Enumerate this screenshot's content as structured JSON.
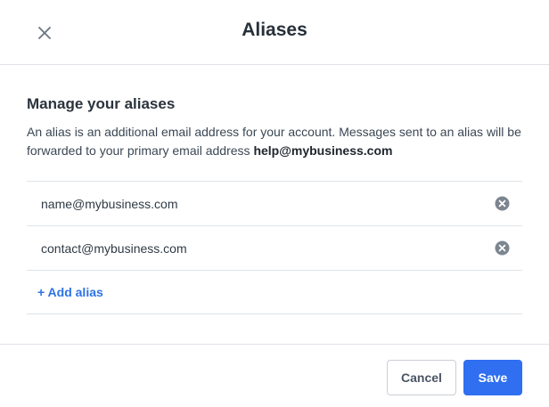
{
  "dialog": {
    "title": "Aliases",
    "close_icon": "close-icon"
  },
  "section": {
    "title": "Manage your aliases",
    "description": "An alias is an additional email address for your account. Messages sent to an alias will be forwarded to your primary email address ",
    "primary_email": "help@mybusiness.com"
  },
  "aliases": [
    {
      "email": "name@mybusiness.com",
      "remove_icon": "remove-circle-icon"
    },
    {
      "email": "contact@mybusiness.com",
      "remove_icon": "remove-circle-icon"
    }
  ],
  "add_alias_label": "+ Add alias",
  "footer": {
    "cancel_label": "Cancel",
    "save_label": "Save"
  },
  "colors": {
    "accent": "#2f6ff0",
    "link": "#2e73e6",
    "divider": "#dfe3e8",
    "remove_icon": "#7d8590"
  }
}
